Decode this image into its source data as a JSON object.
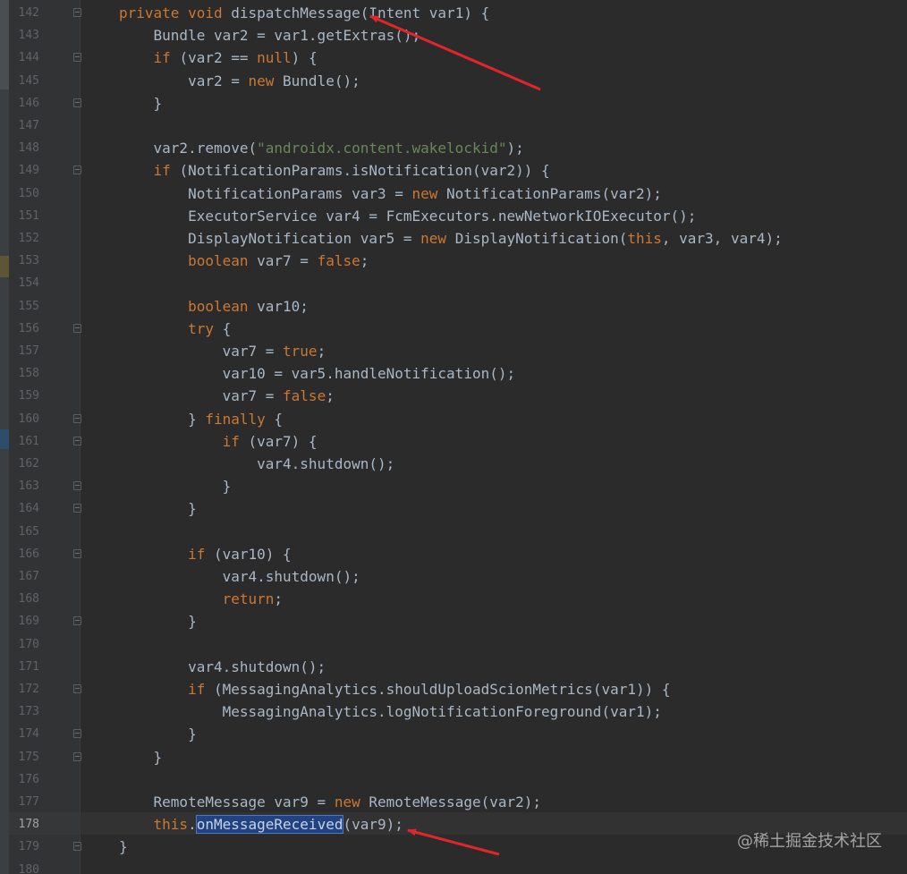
{
  "editor": {
    "language": "java",
    "current_line": "178",
    "lines": [
      {
        "num": "142",
        "tokens": [
          [
            "kw",
            "private void "
          ],
          [
            "t",
            "dispatchMessage(Intent var1) {"
          ]
        ]
      },
      {
        "num": "143",
        "tokens": [
          [
            "t",
            "    Bundle var2 = var1.getExtras();"
          ]
        ]
      },
      {
        "num": "144",
        "tokens": [
          [
            "kw",
            "    if "
          ],
          [
            "t",
            "(var2 == "
          ],
          [
            "kw",
            "null"
          ],
          [
            "t",
            ") {"
          ]
        ]
      },
      {
        "num": "145",
        "tokens": [
          [
            "t",
            "        var2 = "
          ],
          [
            "kw",
            "new "
          ],
          [
            "t",
            "Bundle();"
          ]
        ]
      },
      {
        "num": "146",
        "tokens": [
          [
            "t",
            "    }"
          ]
        ]
      },
      {
        "num": "147",
        "tokens": []
      },
      {
        "num": "148",
        "tokens": [
          [
            "t",
            "    var2.remove("
          ],
          [
            "str",
            "\"androidx.content.wakelockid\""
          ],
          [
            "t",
            ");"
          ]
        ]
      },
      {
        "num": "149",
        "tokens": [
          [
            "kw",
            "    if "
          ],
          [
            "t",
            "(NotificationParams.isNotification(var2)) {"
          ]
        ]
      },
      {
        "num": "150",
        "tokens": [
          [
            "t",
            "        NotificationParams var3 = "
          ],
          [
            "kw",
            "new "
          ],
          [
            "t",
            "NotificationParams(var2);"
          ]
        ]
      },
      {
        "num": "151",
        "tokens": [
          [
            "t",
            "        ExecutorService var4 = FcmExecutors.newNetworkIOExecutor();"
          ]
        ]
      },
      {
        "num": "152",
        "tokens": [
          [
            "t",
            "        DisplayNotification var5 = "
          ],
          [
            "kw",
            "new "
          ],
          [
            "t",
            "DisplayNotification("
          ],
          [
            "kw",
            "this"
          ],
          [
            "t",
            ", var3, var4);"
          ]
        ]
      },
      {
        "num": "153",
        "tokens": [
          [
            "kw",
            "        boolean "
          ],
          [
            "t",
            "var7 = "
          ],
          [
            "kw",
            "false"
          ],
          [
            "t",
            ";"
          ]
        ]
      },
      {
        "num": "154",
        "tokens": []
      },
      {
        "num": "155",
        "tokens": [
          [
            "kw",
            "        boolean "
          ],
          [
            "t",
            "var10;"
          ]
        ]
      },
      {
        "num": "156",
        "tokens": [
          [
            "kw",
            "        try "
          ],
          [
            "t",
            "{"
          ]
        ]
      },
      {
        "num": "157",
        "tokens": [
          [
            "t",
            "            var7 = "
          ],
          [
            "kw",
            "true"
          ],
          [
            "t",
            ";"
          ]
        ]
      },
      {
        "num": "158",
        "tokens": [
          [
            "t",
            "            var10 = var5.handleNotification();"
          ]
        ]
      },
      {
        "num": "159",
        "tokens": [
          [
            "t",
            "            var7 = "
          ],
          [
            "kw",
            "false"
          ],
          [
            "t",
            ";"
          ]
        ]
      },
      {
        "num": "160",
        "tokens": [
          [
            "t",
            "        } "
          ],
          [
            "kw",
            "finally "
          ],
          [
            "t",
            "{"
          ]
        ]
      },
      {
        "num": "161",
        "tokens": [
          [
            "kw",
            "            if "
          ],
          [
            "t",
            "(var7) {"
          ]
        ]
      },
      {
        "num": "162",
        "tokens": [
          [
            "t",
            "                var4.shutdown();"
          ]
        ]
      },
      {
        "num": "163",
        "tokens": [
          [
            "t",
            "            }"
          ]
        ]
      },
      {
        "num": "164",
        "tokens": [
          [
            "t",
            "        }"
          ]
        ]
      },
      {
        "num": "165",
        "tokens": []
      },
      {
        "num": "166",
        "tokens": [
          [
            "kw",
            "        if "
          ],
          [
            "t",
            "(var10) {"
          ]
        ]
      },
      {
        "num": "167",
        "tokens": [
          [
            "t",
            "            var4.shutdown();"
          ]
        ]
      },
      {
        "num": "168",
        "tokens": [
          [
            "kw",
            "            return"
          ],
          [
            "t",
            ";"
          ]
        ]
      },
      {
        "num": "169",
        "tokens": [
          [
            "t",
            "        }"
          ]
        ]
      },
      {
        "num": "170",
        "tokens": []
      },
      {
        "num": "171",
        "tokens": [
          [
            "t",
            "        var4.shutdown();"
          ]
        ]
      },
      {
        "num": "172",
        "tokens": [
          [
            "kw",
            "        if "
          ],
          [
            "t",
            "(MessagingAnalytics.shouldUploadScionMetrics(var1)) {"
          ]
        ]
      },
      {
        "num": "173",
        "tokens": [
          [
            "t",
            "            MessagingAnalytics.logNotificationForeground(var1);"
          ]
        ]
      },
      {
        "num": "174",
        "tokens": [
          [
            "t",
            "        }"
          ]
        ]
      },
      {
        "num": "175",
        "tokens": [
          [
            "t",
            "    }"
          ]
        ]
      },
      {
        "num": "176",
        "tokens": []
      },
      {
        "num": "177",
        "tokens": [
          [
            "t",
            "    RemoteMessage var9 = "
          ],
          [
            "kw",
            "new "
          ],
          [
            "t",
            "RemoteMessage(var2);"
          ]
        ]
      },
      {
        "num": "178",
        "tokens": [
          [
            "kw",
            "    this"
          ],
          [
            "t",
            "."
          ],
          [
            "sel",
            "onMessageReceived"
          ],
          [
            "t",
            "(var9);"
          ]
        ]
      },
      {
        "num": "179",
        "tokens": [
          [
            "t",
            "}"
          ]
        ]
      },
      {
        "num": "180",
        "tokens": []
      }
    ]
  },
  "colors": {
    "background": "#2b2b2b",
    "keyword": "#cc7832",
    "string": "#6a8759",
    "plain": "#a9b7c6",
    "selection": "#214283",
    "annotation_arrow": "#e0262b"
  },
  "icons": [
    "fold-icon",
    "arrow-annotation-icon"
  ],
  "watermark": "@稀土掘金技术社区"
}
